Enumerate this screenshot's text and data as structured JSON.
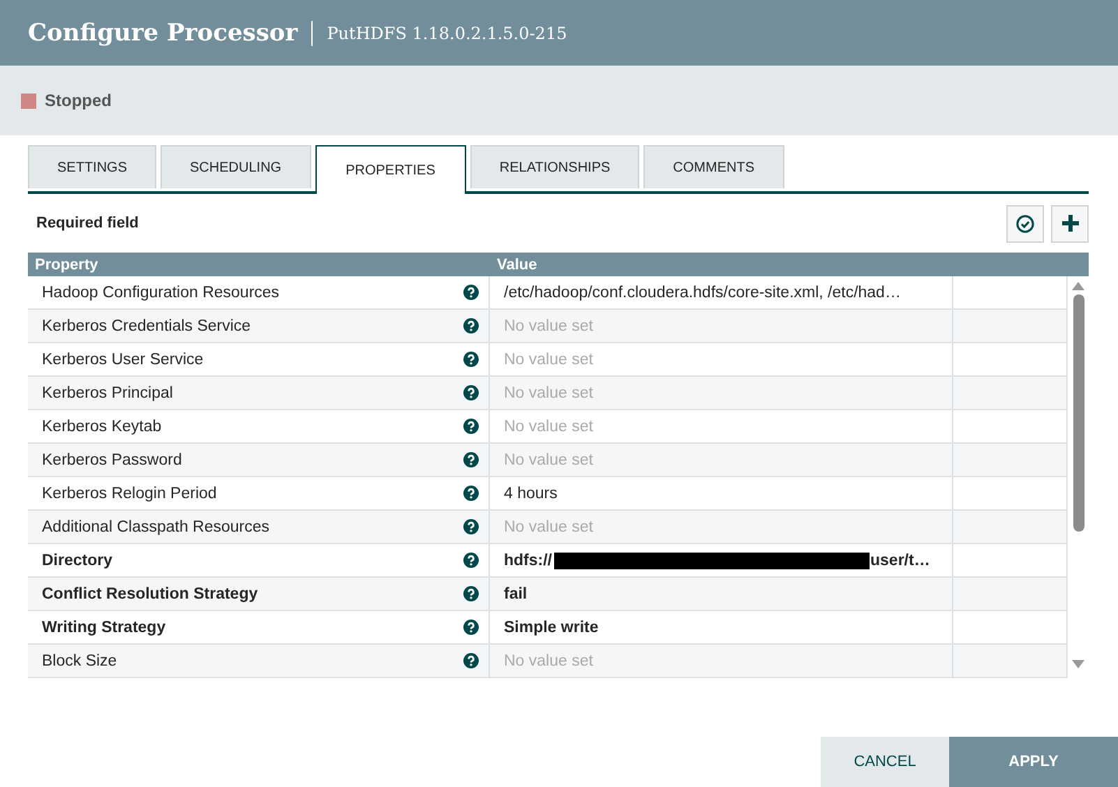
{
  "window": {
    "title": "Configure Processor",
    "subtitle": "PutHDFS 1.18.0.2.1.5.0-215"
  },
  "status": {
    "label": "Stopped",
    "color": "#d18686"
  },
  "tabs": [
    {
      "label": "SETTINGS",
      "selected": false
    },
    {
      "label": "SCHEDULING",
      "selected": false
    },
    {
      "label": "PROPERTIES",
      "selected": true
    },
    {
      "label": "RELATIONSHIPS",
      "selected": false
    },
    {
      "label": "COMMENTS",
      "selected": false
    }
  ],
  "required_note": "Required field",
  "table": {
    "columns": [
      "Property",
      "Value"
    ],
    "rows": [
      {
        "name": "Hadoop Configuration Resources",
        "value": "/etc/hadoop/conf.cloudera.hdfs/core-site.xml, /etc/had…",
        "required": false,
        "set": true
      },
      {
        "name": "Kerberos Credentials Service",
        "value": "No value set",
        "required": false,
        "set": false
      },
      {
        "name": "Kerberos User Service",
        "value": "No value set",
        "required": false,
        "set": false
      },
      {
        "name": "Kerberos Principal",
        "value": "No value set",
        "required": false,
        "set": false
      },
      {
        "name": "Kerberos Keytab",
        "value": "No value set",
        "required": false,
        "set": false
      },
      {
        "name": "Kerberos Password",
        "value": "No value set",
        "required": false,
        "set": false
      },
      {
        "name": "Kerberos Relogin Period",
        "value": "4 hours",
        "required": false,
        "set": true
      },
      {
        "name": "Additional Classpath Resources",
        "value": "No value set",
        "required": false,
        "set": false
      },
      {
        "name": "Directory",
        "value": "hdfs://",
        "value_end": "user/t…",
        "redacted": true,
        "required": true,
        "set": true
      },
      {
        "name": "Conflict Resolution Strategy",
        "value": "fail",
        "required": true,
        "set": true
      },
      {
        "name": "Writing Strategy",
        "value": "Simple write",
        "required": true,
        "set": true
      },
      {
        "name": "Block Size",
        "value": "No value set",
        "required": false,
        "set": false
      }
    ]
  },
  "buttons": [
    {
      "label": "CANCEL",
      "kind": "secondary"
    },
    {
      "label": "APPLY",
      "kind": "primary"
    }
  ]
}
